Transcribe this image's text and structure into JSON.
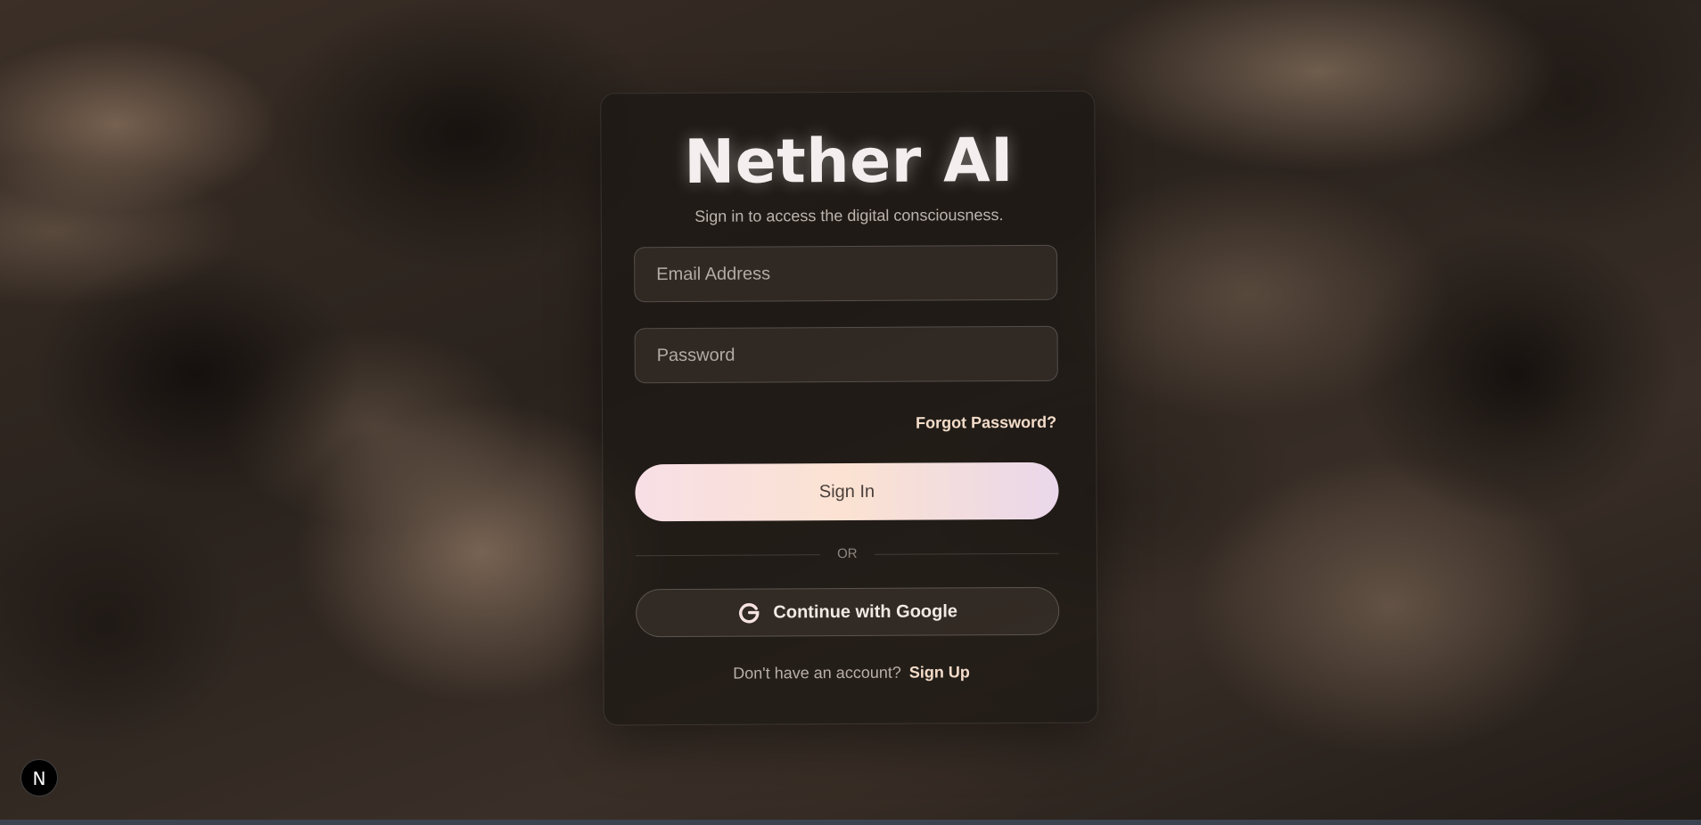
{
  "app": {
    "title": "Nether AI",
    "subtitle": "Sign in to access the digital consciousness."
  },
  "form": {
    "email_placeholder": "Email Address",
    "email_value": "",
    "password_placeholder": "Password",
    "password_value": "",
    "forgot_label": "Forgot Password?",
    "signin_label": "Sign In",
    "divider_label": "OR",
    "google_label": "Continue with Google",
    "google_icon": "google-g-icon"
  },
  "footer": {
    "prompt": "Don't have an account?",
    "signup_label": "Sign Up"
  },
  "dev_badge": {
    "label": "N",
    "icon": "nextjs-icon"
  },
  "colors": {
    "accent_text": "#f3dcc9",
    "button_gradient_start": "#f8dfe6",
    "button_gradient_mid": "#fbe2d2",
    "button_gradient_end": "#ead7ea"
  }
}
